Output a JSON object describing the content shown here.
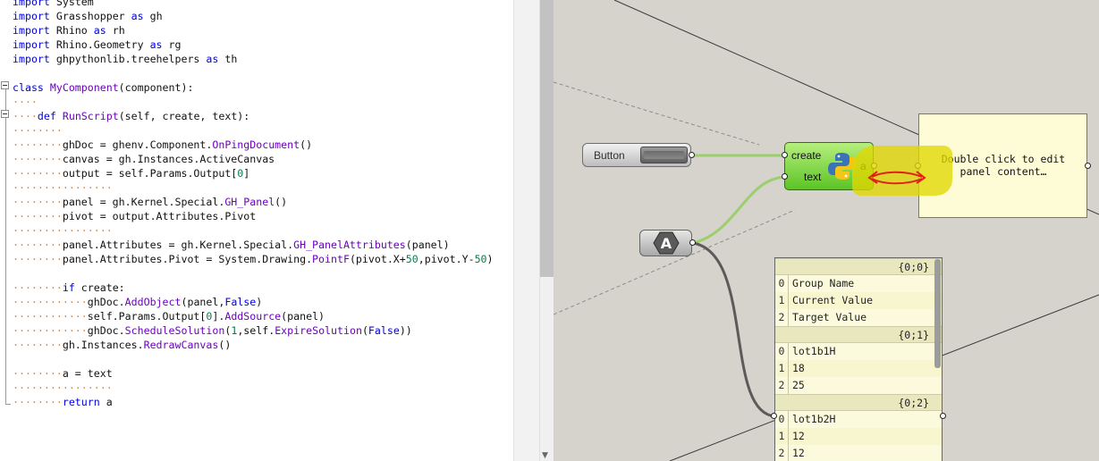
{
  "editor": {
    "lines": [
      {
        "parts": [
          {
            "t": "import",
            "c": "kw"
          },
          {
            "t": " System"
          }
        ]
      },
      {
        "parts": [
          {
            "t": "import",
            "c": "kw"
          },
          {
            "t": " Grasshopper "
          },
          {
            "t": "as",
            "c": "kw"
          },
          {
            "t": " gh"
          }
        ]
      },
      {
        "parts": [
          {
            "t": "import",
            "c": "kw"
          },
          {
            "t": " Rhino "
          },
          {
            "t": "as",
            "c": "kw"
          },
          {
            "t": " rh"
          }
        ]
      },
      {
        "parts": [
          {
            "t": "import",
            "c": "kw"
          },
          {
            "t": " Rhino.Geometry "
          },
          {
            "t": "as",
            "c": "kw"
          },
          {
            "t": " rg"
          }
        ]
      },
      {
        "parts": [
          {
            "t": "import",
            "c": "kw"
          },
          {
            "t": " ghpythonlib.treehelpers "
          },
          {
            "t": "as",
            "c": "kw"
          },
          {
            "t": " th"
          }
        ]
      },
      {
        "parts": []
      },
      {
        "parts": [
          {
            "t": "class",
            "c": "kw"
          },
          {
            "t": " "
          },
          {
            "t": "MyComponent",
            "c": "fn"
          },
          {
            "t": "(component):"
          }
        ]
      },
      {
        "parts": [
          {
            "t": "····",
            "c": "ws"
          }
        ]
      },
      {
        "parts": [
          {
            "t": "····",
            "c": "ws"
          },
          {
            "t": "def",
            "c": "kw"
          },
          {
            "t": " "
          },
          {
            "t": "RunScript",
            "c": "fn"
          },
          {
            "t": "(self, create, text):"
          }
        ]
      },
      {
        "parts": [
          {
            "t": "········",
            "c": "ws"
          }
        ]
      },
      {
        "parts": [
          {
            "t": "········",
            "c": "ws"
          },
          {
            "t": "ghDoc = ghenv.Component."
          },
          {
            "t": "OnPingDocument",
            "c": "fn"
          },
          {
            "t": "()"
          }
        ]
      },
      {
        "parts": [
          {
            "t": "········",
            "c": "ws"
          },
          {
            "t": "canvas = gh.Instances.ActiveCanvas"
          }
        ]
      },
      {
        "parts": [
          {
            "t": "········",
            "c": "ws"
          },
          {
            "t": "output = self.Params.Output["
          },
          {
            "t": "0",
            "c": "num"
          },
          {
            "t": "]"
          }
        ]
      },
      {
        "parts": [
          {
            "t": "················",
            "c": "ws"
          }
        ]
      },
      {
        "parts": [
          {
            "t": "········",
            "c": "ws"
          },
          {
            "t": "panel = gh.Kernel.Special."
          },
          {
            "t": "GH_Panel",
            "c": "fn"
          },
          {
            "t": "()"
          }
        ]
      },
      {
        "parts": [
          {
            "t": "········",
            "c": "ws"
          },
          {
            "t": "pivot = output.Attributes.Pivot"
          }
        ]
      },
      {
        "parts": [
          {
            "t": "················",
            "c": "ws"
          }
        ]
      },
      {
        "parts": [
          {
            "t": "········",
            "c": "ws"
          },
          {
            "t": "panel.Attributes = gh.Kernel.Special."
          },
          {
            "t": "GH_PanelAttributes",
            "c": "fn"
          },
          {
            "t": "(panel)"
          }
        ]
      },
      {
        "parts": [
          {
            "t": "········",
            "c": "ws"
          },
          {
            "t": "panel.Attributes.Pivot = System.Drawing."
          },
          {
            "t": "PointF",
            "c": "fn"
          },
          {
            "t": "(pivot.X+"
          },
          {
            "t": "50",
            "c": "num"
          },
          {
            "t": ",pivot.Y-"
          },
          {
            "t": "50",
            "c": "num"
          },
          {
            "t": ")"
          }
        ]
      },
      {
        "parts": []
      },
      {
        "parts": [
          {
            "t": "········",
            "c": "ws"
          },
          {
            "t": "if",
            "c": "kw"
          },
          {
            "t": " create:"
          }
        ]
      },
      {
        "parts": [
          {
            "t": "············",
            "c": "ws"
          },
          {
            "t": "ghDoc."
          },
          {
            "t": "AddObject",
            "c": "fn"
          },
          {
            "t": "(panel,"
          },
          {
            "t": "False",
            "c": "kw"
          },
          {
            "t": ")"
          }
        ]
      },
      {
        "parts": [
          {
            "t": "············",
            "c": "ws"
          },
          {
            "t": "self.Params.Output["
          },
          {
            "t": "0",
            "c": "num"
          },
          {
            "t": "]."
          },
          {
            "t": "AddSource",
            "c": "fn"
          },
          {
            "t": "(panel)"
          }
        ]
      },
      {
        "parts": [
          {
            "t": "············",
            "c": "ws"
          },
          {
            "t": "ghDoc."
          },
          {
            "t": "ScheduleSolution",
            "c": "fn"
          },
          {
            "t": "("
          },
          {
            "t": "1",
            "c": "num"
          },
          {
            "t": ",self."
          },
          {
            "t": "ExpireSolution",
            "c": "fn"
          },
          {
            "t": "("
          },
          {
            "t": "False",
            "c": "kw"
          },
          {
            "t": "))"
          }
        ]
      },
      {
        "parts": [
          {
            "t": "········",
            "c": "ws"
          },
          {
            "t": "gh.Instances."
          },
          {
            "t": "RedrawCanvas",
            "c": "fn"
          },
          {
            "t": "()"
          }
        ]
      },
      {
        "parts": []
      },
      {
        "parts": [
          {
            "t": "········",
            "c": "ws"
          },
          {
            "t": "a = text"
          }
        ]
      },
      {
        "parts": [
          {
            "t": "················",
            "c": "ws"
          }
        ]
      },
      {
        "parts": [
          {
            "t": "········",
            "c": "ws"
          },
          {
            "t": "return",
            "c": "kw"
          },
          {
            "t": " a"
          }
        ]
      }
    ]
  },
  "canvas": {
    "button": {
      "label": "Button"
    },
    "python_component": {
      "input_create": "create",
      "input_text": "text",
      "output_a": "a",
      "icon": "python-logo-icon"
    },
    "panel": {
      "text_line1": "Double click to edit",
      "text_line2": "panel content…"
    },
    "text_param": {
      "icon": "text-param-hex-icon",
      "glyph": "A"
    },
    "tree_panel": {
      "branches": [
        {
          "path": "{0;0}",
          "items": [
            {
              "i": "0",
              "v": "Group Name"
            },
            {
              "i": "1",
              "v": "Current Value"
            },
            {
              "i": "2",
              "v": "Target Value"
            }
          ]
        },
        {
          "path": "{0;1}",
          "items": [
            {
              "i": "0",
              "v": "lot1b1H"
            },
            {
              "i": "1",
              "v": "18"
            },
            {
              "i": "2",
              "v": "25"
            }
          ]
        },
        {
          "path": "{0;2}",
          "items": [
            {
              "i": "0",
              "v": "lot1b2H"
            },
            {
              "i": "1",
              "v": "12"
            },
            {
              "i": "2",
              "v": "12"
            }
          ]
        }
      ]
    },
    "colors": {
      "canvas": "#d5d3cb",
      "component_green": "#7ed34a",
      "highlight": "#e1d700",
      "arrow": "#e0201a",
      "panel": "#fdfcd6"
    }
  }
}
